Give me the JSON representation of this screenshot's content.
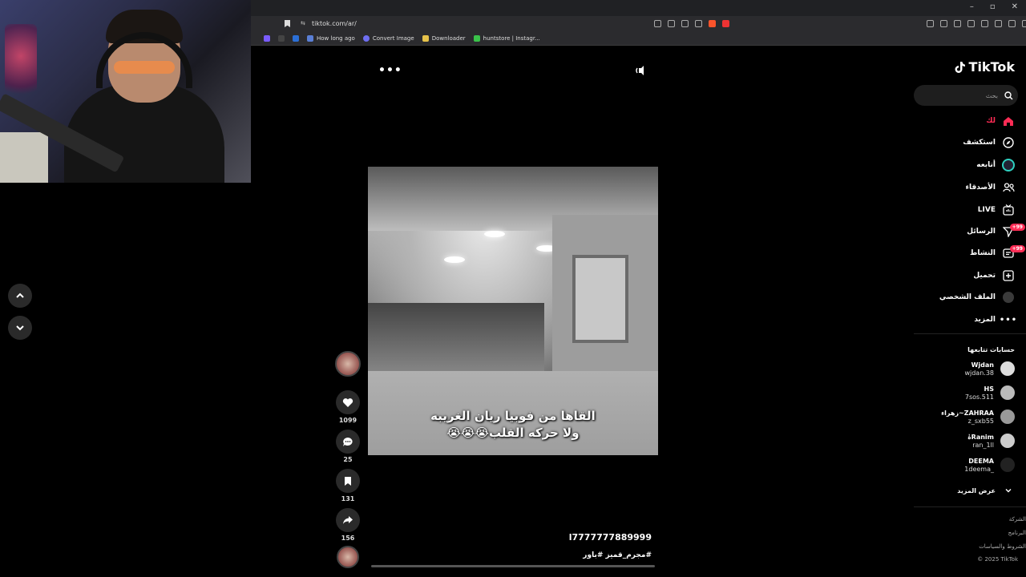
{
  "browser": {
    "url": "tiktok.com/ar/",
    "bookmarks": [
      "How long ago",
      "Convert Image",
      "Downloader",
      "huntstore | Instagr..."
    ],
    "window_controls": [
      "–",
      "▫",
      "✕"
    ]
  },
  "tiktok": {
    "logo": "TikTok",
    "search_placeholder": "بحث",
    "nav": [
      {
        "label": "لك",
        "icon": "home-icon",
        "active": true
      },
      {
        "label": "استكشف",
        "icon": "compass-icon"
      },
      {
        "label": "أتابعه",
        "icon": "following-avatar-icon"
      },
      {
        "label": "الأصدقاء",
        "icon": "friends-icon"
      },
      {
        "label": "LIVE",
        "icon": "live-icon"
      },
      {
        "label": "الرسائل",
        "icon": "messages-icon",
        "badge": "+99"
      },
      {
        "label": "النشاط",
        "icon": "activity-icon",
        "badge": "+99"
      },
      {
        "label": "تحميل",
        "icon": "upload-icon"
      },
      {
        "label": "الملف الشخصي",
        "icon": "profile-icon"
      },
      {
        "label": "المزيد",
        "icon": "more-icon"
      }
    ],
    "following_title": "حسابات تتابعها",
    "accounts": [
      {
        "name": "Wjdan",
        "username": "wjdan.38"
      },
      {
        "name": "HS",
        "username": "7sos.511"
      },
      {
        "name": "ZAHRAA~زهراء",
        "username": "z_sxb55"
      },
      {
        "name": "Ranimہٰ",
        "username": "ran_1ll"
      },
      {
        "name": "DEEMA",
        "username": "_1deema"
      }
    ],
    "see_more": "عرض المزيد",
    "footer": [
      "الشركة",
      "البرنامج",
      "الشروط والسياسات",
      "© 2025 TikTok"
    ]
  },
  "video": {
    "caption_line1": "القاها من فوبيا ريان الغريبه",
    "caption_line2": "ولا حركه القلب😭😭😭",
    "author": "l7777777889999",
    "hashtags": "#مجرم_قميز #باور",
    "likes": "1099",
    "comments": "25",
    "saves": "131",
    "shares": "156",
    "progress": 0.0
  },
  "colors": {
    "accent": "#fe2c55",
    "background": "#000000"
  }
}
